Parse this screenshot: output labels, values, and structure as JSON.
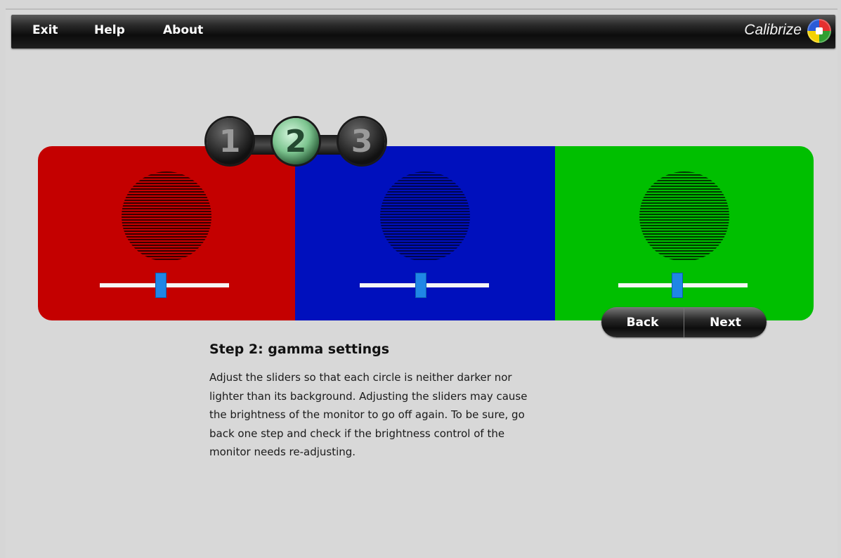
{
  "menu": {
    "items": [
      {
        "label": "Exit"
      },
      {
        "label": "Help"
      },
      {
        "label": "About"
      }
    ],
    "brand": "Calibrize",
    "logo_icon": "calibrize-logo-icon"
  },
  "steps": {
    "items": [
      "1",
      "2",
      "3"
    ],
    "active": "2"
  },
  "panels": [
    {
      "color_name": "red",
      "background": "#c40000",
      "slider_value_percent": 47
    },
    {
      "color_name": "blue",
      "background": "#0010bd",
      "slider_value_percent": 47
    },
    {
      "color_name": "green",
      "background": "#00bf00",
      "slider_value_percent": 45
    }
  ],
  "navigation": {
    "back_label": "Back",
    "next_label": "Next"
  },
  "content": {
    "heading": "Step 2: gamma settings",
    "lines": [
      "Adjust the sliders so that each circle is neither darker nor",
      "lighter than its background. Adjusting the sliders may cause",
      "the brightness of the monitor to go off again. To be sure, go",
      "back one step and check if the brightness control of the",
      "monitor needs re-adjusting."
    ]
  },
  "colors": {
    "slider_thumb": "#1f86e6",
    "active_step": "#7cc48f"
  }
}
